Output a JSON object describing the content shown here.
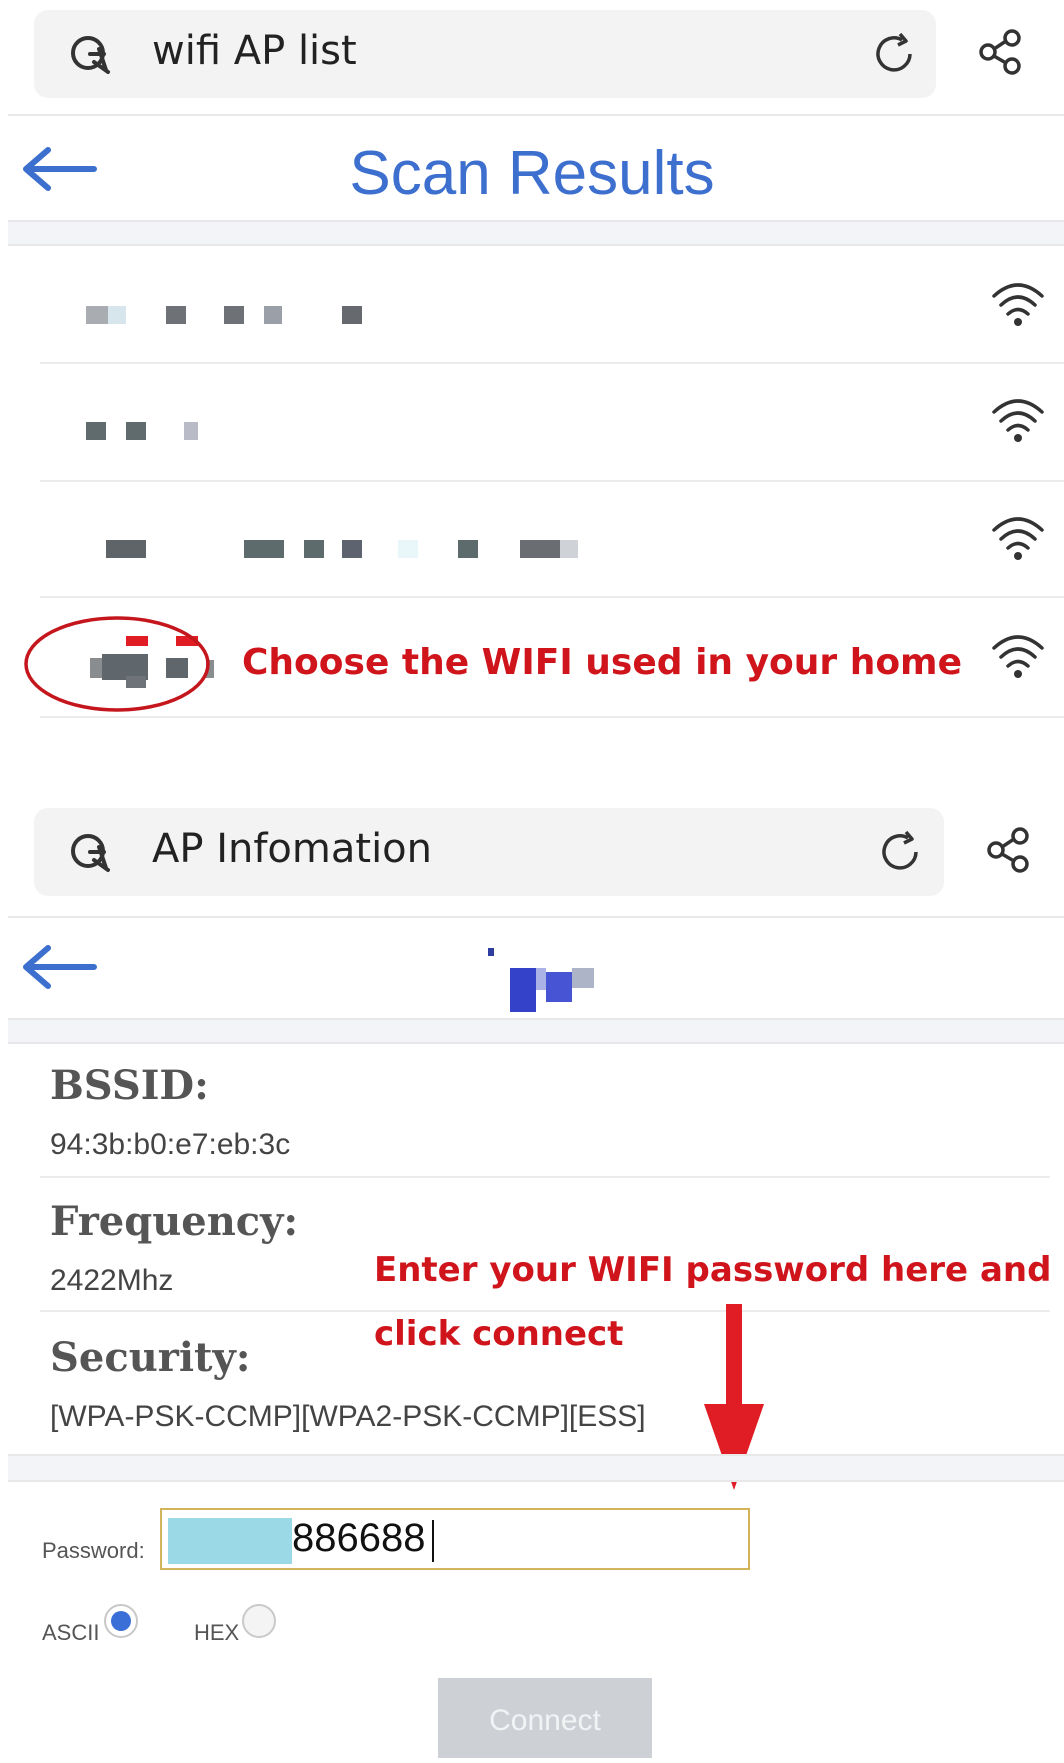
{
  "top_search": {
    "query": "wifi AP list"
  },
  "scan_page": {
    "title": "Scan Results"
  },
  "networks": [
    {
      "name": "",
      "signal": "wifi-full"
    },
    {
      "name": "",
      "signal": "wifi-full"
    },
    {
      "name": "",
      "signal": "wifi-full"
    },
    {
      "name": "",
      "signal": "wifi-full"
    }
  ],
  "annotations": {
    "choose": "Choose the WIFI used in your home",
    "enter_line1": "Enter your WIFI password here and",
    "enter_line2": "click connect"
  },
  "ap_search": {
    "query": "AP Infomation"
  },
  "ap_info": {
    "bssid_label": "BSSID:",
    "bssid_value": "94:3b:b0:e7:eb:3c",
    "frequency_label": "Frequency:",
    "frequency_value": "2422Mhz",
    "security_label": "Security:",
    "security_value": "[WPA-PSK-CCMP][WPA2-PSK-CCMP][ESS]"
  },
  "form": {
    "password_label": "Password:",
    "password_value": "886688",
    "ascii_label": "ASCII",
    "hex_label": "HEX",
    "encoding_selected": "ASCII",
    "connect_label": "Connect"
  },
  "colors": {
    "accent": "#3d6fcf",
    "annotation": "#d0141c",
    "radio_selected": "#3a6fd8"
  }
}
